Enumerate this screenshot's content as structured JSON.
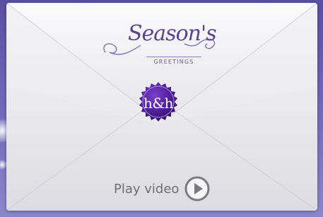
{
  "card": {
    "logo_script": "Season's",
    "logo_subtitle": "GREETINGS",
    "seal_monogram": "h&h",
    "play_label": "Play video"
  },
  "icons": {
    "seal": "wax-seal-icon",
    "play": "play-circle-icon"
  },
  "colors": {
    "background": "#6c64b4",
    "envelope": "#ededf1",
    "seal": "#4e1f94",
    "logo": "#57468f",
    "play_icon": "#7b7b7e"
  }
}
